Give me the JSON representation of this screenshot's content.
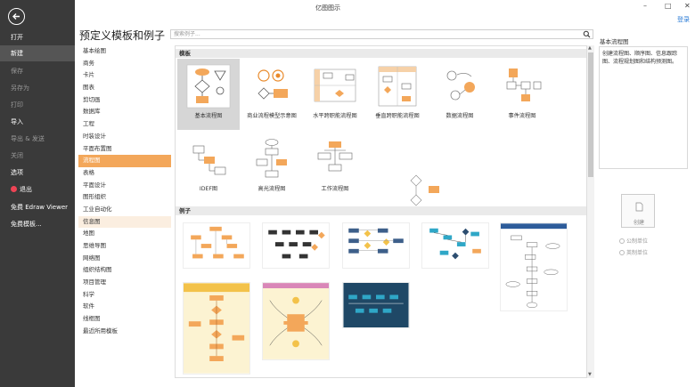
{
  "window": {
    "title": "亿图图示",
    "login": "登录",
    "minimize": "–",
    "maximize": "□",
    "close": "✕"
  },
  "sidebar": {
    "items": [
      {
        "label": "打开",
        "state": "normal"
      },
      {
        "label": "新建",
        "state": "active"
      },
      {
        "label": "保存",
        "state": "dim"
      },
      {
        "label": "另存为",
        "state": "dim"
      },
      {
        "label": "打印",
        "state": "dim"
      },
      {
        "label": "导入",
        "state": "normal"
      },
      {
        "label": "导出 & 发送",
        "state": "dim"
      },
      {
        "label": "关闭",
        "state": "dim"
      },
      {
        "label": "选项",
        "state": "normal"
      },
      {
        "label": "退出",
        "state": "normal"
      },
      {
        "label": "免费 Edraw Viewer",
        "state": "normal"
      },
      {
        "label": "免费模板...",
        "state": "normal"
      }
    ]
  },
  "main": {
    "title": "预定义模板和例子",
    "search_placeholder": "搜索例子..."
  },
  "categories": [
    "基本绘图",
    "商务",
    "卡片",
    "图表",
    "剪切画",
    "数据库",
    "工程",
    "时装设计",
    "平面布置图",
    "流程图",
    "表格",
    "平面设计",
    "图形组织",
    "工业自动化",
    "信息图",
    "地图",
    "思维导图",
    "网络图",
    "组织结构图",
    "项目管理",
    "科学",
    "软件",
    "线框图",
    "最近所用模板"
  ],
  "active_category": "流程图",
  "hover_category": "信息图",
  "templates_section": "模板",
  "templates": [
    {
      "label": "基本流程图",
      "selected": true
    },
    {
      "label": "商业流程模型示意图",
      "selected": false
    },
    {
      "label": "水平跨职能流程图",
      "selected": false
    },
    {
      "label": "垂直跨职能流程图",
      "selected": false
    },
    {
      "label": "数据流程图",
      "selected": false
    },
    {
      "label": "事件流程图",
      "selected": false
    },
    {
      "label": "IDEF图",
      "selected": false
    },
    {
      "label": "高光流程图",
      "selected": false
    },
    {
      "label": "工作流程图",
      "selected": false
    }
  ],
  "examples_section": "例子",
  "right_panel": {
    "title": "基本流程图",
    "description": "创建流程图、顺序图、信息跟踪图、流程规划图和结构预测图。",
    "create_label": "创建",
    "unit_options": [
      "公制单位",
      "英制单位"
    ]
  },
  "colors": {
    "sidebar_bg": "#3a3a3a",
    "accent_orange": "#f3a75a",
    "selected_tile": "#d6d6d6"
  }
}
